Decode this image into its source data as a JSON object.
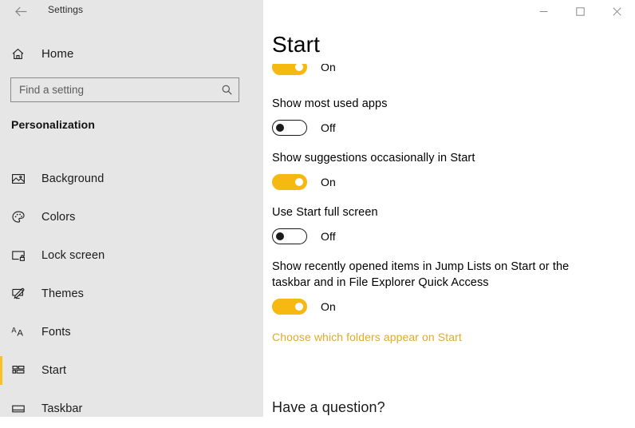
{
  "titlebar": {
    "back_icon": "back-arrow-icon",
    "title": "Settings",
    "minimize_label": "Minimize",
    "maximize_label": "Maximize",
    "close_label": "Close"
  },
  "sidebar": {
    "home": {
      "label": "Home",
      "icon": "home-icon"
    },
    "search": {
      "value": "",
      "placeholder": "Find a setting",
      "icon": "search-icon"
    },
    "section_title": "Personalization",
    "accent_color": "#f5c324",
    "items": [
      {
        "label": "Background",
        "icon": "image-icon",
        "selected": false
      },
      {
        "label": "Colors",
        "icon": "palette-icon",
        "selected": false
      },
      {
        "label": "Lock screen",
        "icon": "lock-screen-icon",
        "selected": false
      },
      {
        "label": "Themes",
        "icon": "themes-icon",
        "selected": false
      },
      {
        "label": "Fonts",
        "icon": "fonts-icon",
        "selected": false
      },
      {
        "label": "Start",
        "icon": "start-tiles-icon",
        "selected": true
      },
      {
        "label": "Taskbar",
        "icon": "taskbar-icon",
        "selected": false
      }
    ]
  },
  "main": {
    "page_title": "Start",
    "toggle_on_color": "#f5b912",
    "link_color": "#e0ab2b",
    "settings": [
      {
        "label": "",
        "state": "On",
        "on": true,
        "clipped": true
      },
      {
        "label": "Show most used apps",
        "state": "Off",
        "on": false,
        "clipped": false
      },
      {
        "label": "Show suggestions occasionally in Start",
        "state": "On",
        "on": true,
        "clipped": false
      },
      {
        "label": "Use Start full screen",
        "state": "Off",
        "on": false,
        "clipped": false
      },
      {
        "label": "Show recently opened items in Jump Lists on Start or the taskbar and in File Explorer Quick Access",
        "state": "On",
        "on": true,
        "clipped": false
      }
    ],
    "folders_link": "Choose which folders appear on Start",
    "help_heading": "Have a question?"
  }
}
